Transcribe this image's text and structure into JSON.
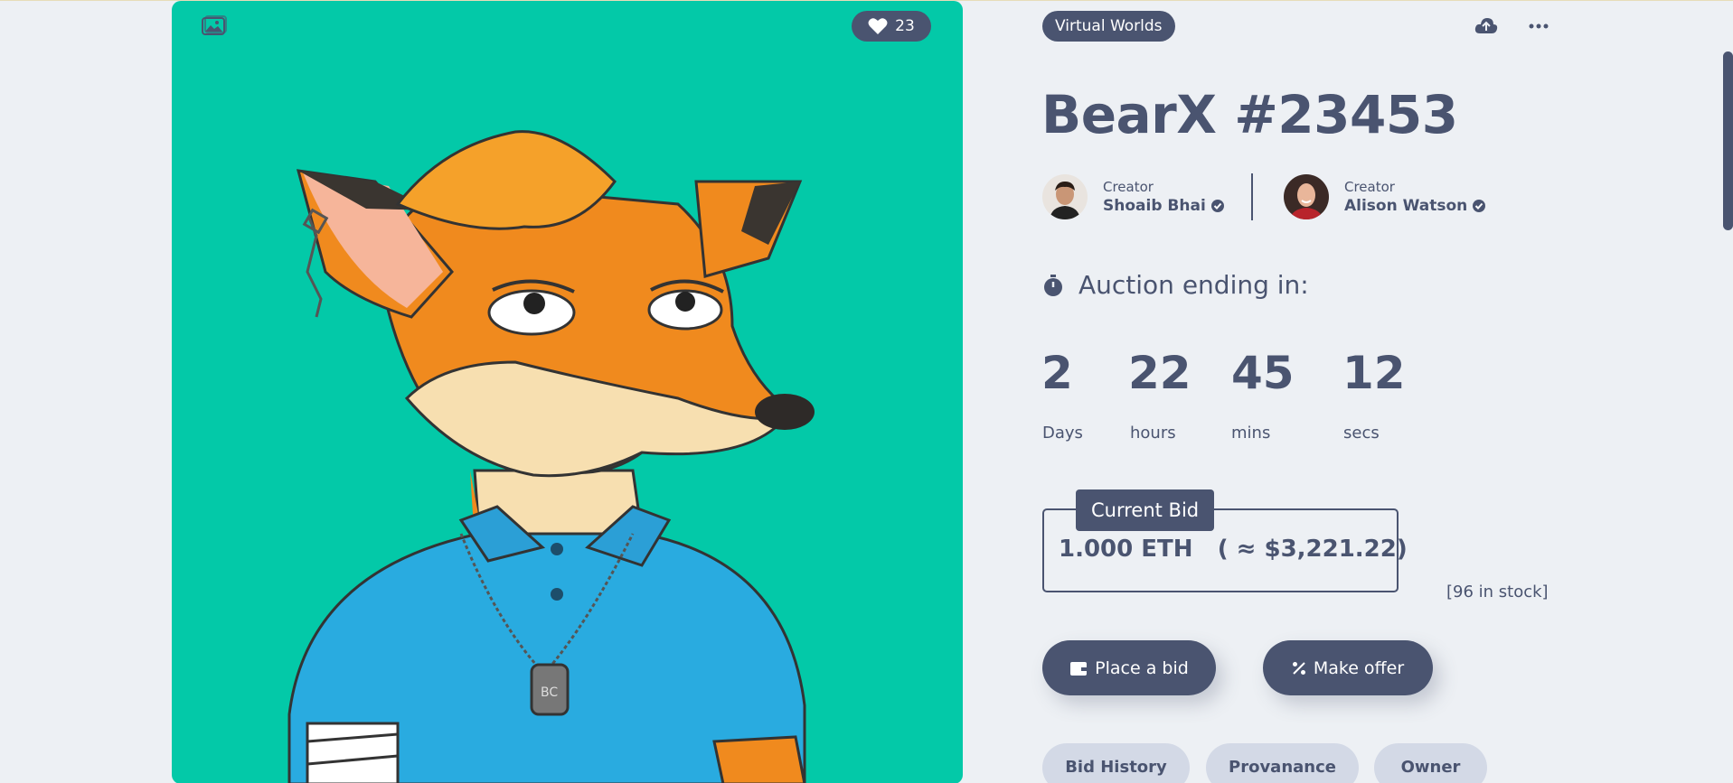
{
  "artwork": {
    "likes": "23",
    "image_icon": "image-icon",
    "heart_icon": "heart-icon",
    "tag_text": "BC"
  },
  "nft": {
    "category": "Virtual Worlds",
    "title": "BearX #23453"
  },
  "actions": {
    "share_icon": "upload-cloud-icon",
    "more_icon": "more-horizontal-icon"
  },
  "creators": [
    {
      "role": "Creator",
      "name": "Shoaib Bhai"
    },
    {
      "role": "Creator",
      "name": "Alison Watson"
    }
  ],
  "auction": {
    "label": "Auction ending in:",
    "countdown": [
      {
        "value": "2",
        "unit": "Days"
      },
      {
        "value": "22",
        "unit": "hours"
      },
      {
        "value": "45",
        "unit": "mins"
      },
      {
        "value": "12",
        "unit": "secs"
      }
    ]
  },
  "bid": {
    "label": "Current Bid",
    "value": "1.000 ETH   ( ≈ $3,221.22)",
    "stock": "[96 in stock]"
  },
  "buttons": {
    "place_bid": "Place a bid",
    "make_offer": "Make offer"
  },
  "tabs": [
    "Bid History",
    "Provanance",
    "Owner"
  ],
  "colors": {
    "primary": "#4a5470",
    "background": "#edf0f4",
    "art_background": "#03c9a8",
    "pill": "#d3d9e6"
  }
}
